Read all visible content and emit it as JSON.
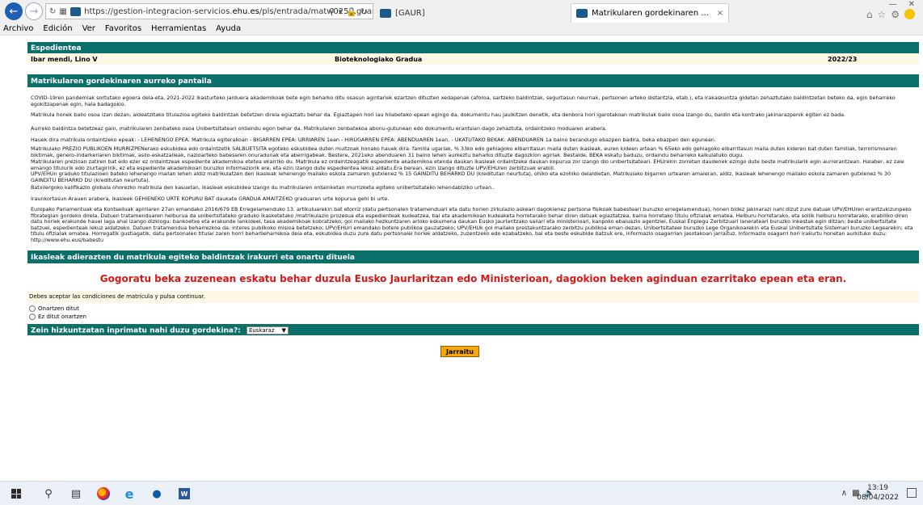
{
  "browser": {
    "url_prefix": "https://gestion-integracion-servicios.",
    "url_domain": "ehu.es",
    "url_suffix": "/pls/entrada/matw0250.guardar",
    "tab1_label": "[GAUR]",
    "tab2_label": "Matrikularen gordekinaren ...",
    "tab_close": "×"
  },
  "menu": [
    "Archivo",
    "Edición",
    "Ver",
    "Favoritos",
    "Herramientas",
    "Ayuda"
  ],
  "expedient": {
    "header": "Espedientea",
    "student": "Ibar mendi, Lino V",
    "degree": "Bioteknologiako Gradua",
    "year": "2022/23"
  },
  "section1_title": "Matrikularen gordekinaren aurreko pantaila",
  "paragraphs": [
    "COVID-19ren pandemiak sortutako egoera dela-eta, 2021-2022 ikasturteko jarduera akademikoak bete egin beharko ditu osasun agintariek ezartzen dituzten xedapenak (aforoa, sartzeko baldintzak, segurtasun neurriak, pertsonen arteko distantzia, etab.), eta irakaskuntza gidetan zehaztutako baldintzetan beteko da, egin beharreko egokitzapenak egin, hala badagokio.",
    "Matrikula honek balio osoa izan dezan, aldeatzitako titulazioa egiteko baldintzak betetzen direla egiaztatu behar da. Egiaztapen hori lau hilabeteko epean egingo da, dokumentu hau jaulkitzen denetik, eta denbora hori igarotakoan matrikulak balio osoa izango du, baldin eta kontrako jakinarazpenik egiten ez bada.",
    "Aurreko baldintza betetzeaz gain, matrikularen zenbateko osoa Unibertsitateari ordaindu egon behar da. Matrikularen zenbatekoa abonu-gutunean edo dokumentu erantsian dago zehaztuta, ordaintzeko moduaren arabera.",
    "Hauek dira matrikula ordaintzeko epeak: - LEHENENGO EPEA: Matrikula egiterakoan - BIGARREN EPEA: URRIAREN 1ean - HIRUGARREN EPEA: ABENDUAREN 1ean. - UKATUTAKO BEKAK: ABENDUAREN 1a baino berandugo ebazpen badira, beka ebazpen den egunean.",
    "Matrikulako PREZIO PUBLIKOEN MURRIZPENerako eskubidea edo ordaintzetik SALBUETSITA egoteko eskubidea duten multzoak honako hauek dira: familia ugariak, % 33ko edo gehiagoko elbarritasun maila duten ikasleak, euren kideen artean % 65eko edo gehiagoko elbarritasun maila duten kideren bat duten familiak, terrorismoaren biktimak, genero-indarkeriaren biktimak, asilo-eskatzaileak, nazioarteko babesaren onuradunak eta aberrigabeak. Bestere, 2021eko abenduaren 31 baino lehen aurkeztu beharko dituzte dagozkion agiriak. Bestalde, BEKA eskatu baduzu, ordaindu beharreko kalkulatuko dugu.",
    "Matrikularen prezioan zatiren bat edo ezer ez ordaintzeak espediente akademikoa etetea ekarriko du. Matrikula ez ordaintzeagatik espediente akademikoa etenda daukan ikasleak ordaintzeke daukan kopurua zor izango dio unibertsitateari. EHUrekin zorretan daudenek ezingo dute beste matrikularik egin aurrerantzean. Halaber, ez zaie emango titulurik edo ziurtagiririk, ez eta espediente akademikoari buruzko informaziorik ere, eta ezin izango dute espedientea lekuz aldatu.Era berean, ezin izango dituzte UPV/EHUren zerbitzuak erabili.",
    "UPV/EHUn graduko titulazioen bateko lehenengo mailan lehen aldiz matrikulatzen den ikasleak lehenengo mailako eskola zamaren gutxienez % 15 GAINDITU BEHARKO DU (kreditutan neurtuta), ohiko eta ezohiko deialdietan. Matrikulako bigarren urtearen amaieran, aldiz, ikasleak lehenengo mailako eskola zamaren gutxienez % 30 GAINDITU BEHARKO DU (kreditutan neurtuta).",
    "Batxilergoko kalifikazio globala ohorezko matrikula den kasuetan, ikasleak eskubidea izango du matrikularen ordainketan murrizketa egiteko unibertsitateko lehendabiziko urtean..",
    "Iraunkortasun Arauen arabera, ikasleek GEHIENEKO URTE KOPURU BAT daukate GRADUA AMAITZEKO graduaren urte kopurua gehi bi urte.",
    "Europako Parlamentuak eta Kontseiluak apirilaren 27an emandako 2016/679 EB Erregelamenduko 13. artikuluarekin bat etorriz (datu pertsonalen tratamenduari eta datu horien zirkulazio askeari dagokienez pertsona fisikoak babesteari buruzko erregelamendua), honen bidez jakinarazi nahi dizut zure datuak UPV/EHUren erantzukizunpeko fitxategian gordeko direla. Datuen tratamenduaren helburua da unibertsitateko graduko ikasketetako /matrikulazio prozesua eta espedienteak kudeatzea, bai eta akademikoan kudeaketa horretarako behar diren datuak egiaztatzea, baina horretako titulu ofizialak ematea. Helburu horretarako, eta soilik helburu horretarako, erabiliko diren datu horiek erakunde hauei laga ahal izango dizkiogu: bankoetxe eta erakunde lankideei, tasa akademikoak kobratzeko; goi mailako hezkuntzaren arloko eskumena daukan Eusko Jaurlaritzako sailari eta ministerioari, kanpoko ebaluazio agentziei, Euskal Enplegu Zerbitzuari lanerateari buruzko inkestak egin ditzan; beste unibertsitate batzuei, espedienteak lekuz aldatzeko. Datuen tratamendua beharrezkoa da: interes publikoko misioa betetzeko; UPV/EHUri emandako botere publikoa gauzatzeko; UPV/EHUk goi mailako prestakuntzarako zerbitzu publikoa eman dezan, Unibertsitateei buruzko Lege Organikoarekin eta Euskal Unibertsitate Sistemari buruzko Legearekin; eta titulu ofizialak ematea. Horregatik gustiagatik, datu pertsonalen titular zaren horri beharbeharrekoa dela eta, eskubidea duzu zure datu pertsonalei horiek aldatzeko, zuzentzeko edo ezabatzeko, bai eta beste eskubide batzuk ere, informazio osagarrian jasotakoan jarraituz. Informazio osagarri hori irakurtu honetan aurkituko duzu: http://www.ehu.eus/babestu"
  ],
  "section2_title": "Ikasleak adierazten du matrikula egiteko baldintzak irakurri eta onartu dituela",
  "alert": "Gogoratu beka zuzenean eskatu behar duzula Eusko Jaurlaritzan edo Ministerioan, dagokion beken aginduan ezarritako epean eta eran.",
  "accept_label": "Debes aceptar las condiciones de matrícula y pulsa continuar.",
  "radio_accept": "Onartzen ditut",
  "radio_reject": "Ez ditut onartzen",
  "language_question": "Zein hizkuntzatan inprimatu nahi duzu gordekina?:",
  "language_selected": "Euskaraz",
  "submit_label": "Jarraitu",
  "taskbar": {
    "time": "13:19",
    "date": "08/04/2022",
    "word_label": "W"
  }
}
